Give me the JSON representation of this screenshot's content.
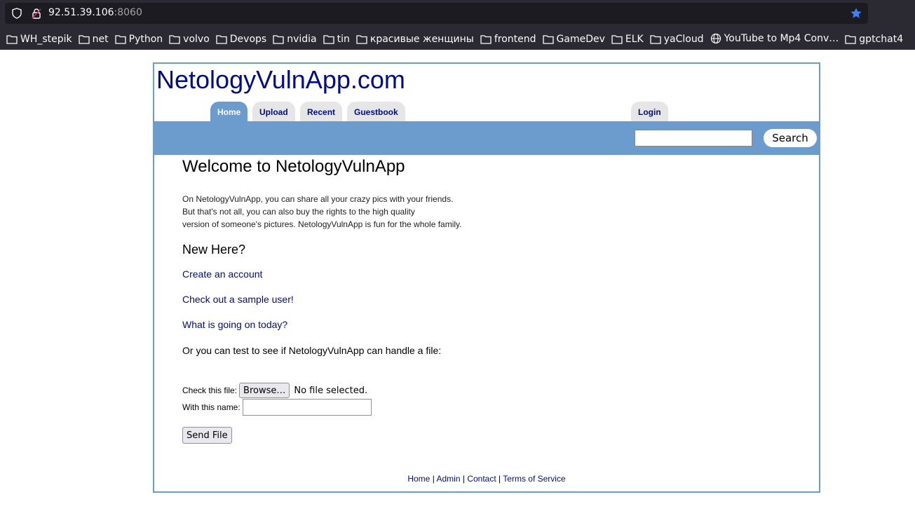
{
  "browser": {
    "url_host": "92.51.39.106",
    "url_port": ":8060",
    "bookmarks": [
      {
        "label": "WH_stepik",
        "icon": "folder-icon"
      },
      {
        "label": "net",
        "icon": "folder-icon"
      },
      {
        "label": "Python",
        "icon": "folder-icon"
      },
      {
        "label": "volvo",
        "icon": "folder-icon"
      },
      {
        "label": "Devops",
        "icon": "folder-icon"
      },
      {
        "label": "nvidia",
        "icon": "folder-icon"
      },
      {
        "label": "tin",
        "icon": "folder-icon"
      },
      {
        "label": "красивые женщины",
        "icon": "folder-icon"
      },
      {
        "label": "frontend",
        "icon": "folder-icon"
      },
      {
        "label": "GameDev",
        "icon": "folder-icon"
      },
      {
        "label": "ELK",
        "icon": "folder-icon"
      },
      {
        "label": "yaCloud",
        "icon": "folder-icon"
      },
      {
        "label": "YouTube to Mp4 Conv…",
        "icon": "globe-icon"
      },
      {
        "label": "gptchat4",
        "icon": "folder-icon"
      }
    ]
  },
  "site": {
    "logo": "NetologyVulnApp.com",
    "tabs": {
      "home": "Home",
      "upload": "Upload",
      "recent": "Recent",
      "guestbook": "Guestbook",
      "login": "Login"
    },
    "search_button": "Search"
  },
  "main": {
    "title": "Welcome to NetologyVulnApp",
    "intro_line1": "On NetologyVulnApp, you can share all your crazy pics with your friends.",
    "intro_line2": "But that's not all, you can also buy the rights to the high quality",
    "intro_line3": "version of someone's pictures. NetologyVulnApp is fun for the whole family.",
    "new_here": "New Here?",
    "link_create": "Create an account",
    "link_sample": "Check out a sample user!",
    "link_today": "What is going on today?",
    "or_text": "Or you can test to see if NetologyVulnApp can handle a file:",
    "check_file_label": "Check this file:",
    "browse_label": "Browse…",
    "no_file": "No file selected.",
    "name_label": "With this name:",
    "send_label": "Send File"
  },
  "footer": {
    "home": "Home",
    "admin": "Admin",
    "contact": "Contact",
    "terms": "Terms of Service"
  },
  "colors": {
    "accent": "#6c9cce",
    "link": "#000c8c",
    "star": "#3b82f6"
  }
}
